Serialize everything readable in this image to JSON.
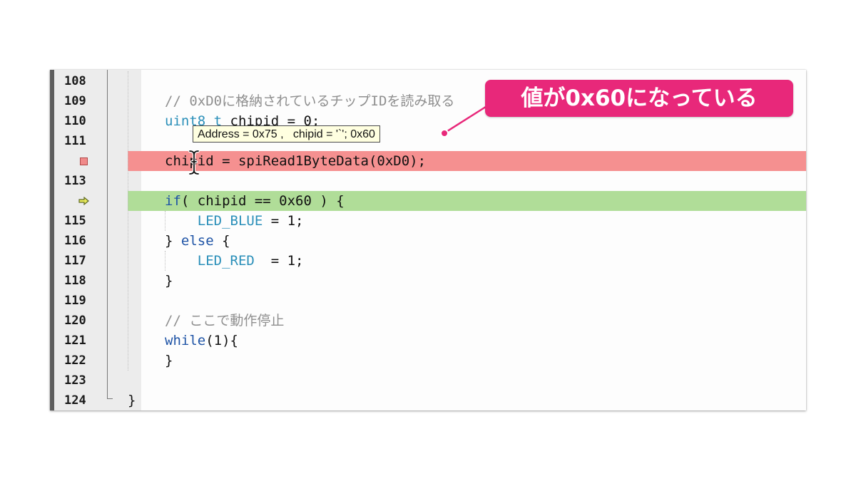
{
  "editor": {
    "lines": [
      {
        "num": "108",
        "marker": "",
        "highlight": "",
        "tokens": []
      },
      {
        "num": "109",
        "marker": "",
        "highlight": "",
        "tokens": [
          {
            "cls": "cm",
            "text": "// 0xD0に格納されているチップIDを読み取る"
          }
        ]
      },
      {
        "num": "110",
        "marker": "",
        "highlight": "",
        "tokens": [
          {
            "cls": "id",
            "text": "uint8_t"
          },
          {
            "cls": "",
            "text": " chipid = 0;"
          }
        ]
      },
      {
        "num": "111",
        "marker": "",
        "highlight": "",
        "tokens": []
      },
      {
        "num": "",
        "marker": "breakpoint",
        "highlight": "red",
        "tokens": [
          {
            "cls": "",
            "text": "chipid = spiRead1ByteData(0xD0);"
          }
        ]
      },
      {
        "num": "113",
        "marker": "",
        "highlight": "",
        "tokens": []
      },
      {
        "num": "",
        "marker": "current",
        "highlight": "green",
        "tokens": [
          {
            "cls": "kw",
            "text": "if"
          },
          {
            "cls": "",
            "text": "( chipid == 0x60 ) {"
          }
        ]
      },
      {
        "num": "115",
        "marker": "",
        "highlight": "",
        "tokens": [
          {
            "cls": "",
            "text": "    "
          },
          {
            "cls": "id",
            "text": "LED_BLUE"
          },
          {
            "cls": "",
            "text": " = 1;"
          }
        ]
      },
      {
        "num": "116",
        "marker": "",
        "highlight": "",
        "tokens": [
          {
            "cls": "",
            "text": "} "
          },
          {
            "cls": "kw",
            "text": "else"
          },
          {
            "cls": "",
            "text": " {"
          }
        ]
      },
      {
        "num": "117",
        "marker": "",
        "highlight": "",
        "tokens": [
          {
            "cls": "",
            "text": "    "
          },
          {
            "cls": "id",
            "text": "LED_RED"
          },
          {
            "cls": "",
            "text": "  = 1;"
          }
        ]
      },
      {
        "num": "118",
        "marker": "",
        "highlight": "",
        "tokens": [
          {
            "cls": "",
            "text": "}"
          }
        ]
      },
      {
        "num": "119",
        "marker": "",
        "highlight": "",
        "tokens": []
      },
      {
        "num": "120",
        "marker": "",
        "highlight": "",
        "tokens": [
          {
            "cls": "cm",
            "text": "// ここで動作停止"
          }
        ]
      },
      {
        "num": "121",
        "marker": "",
        "highlight": "",
        "tokens": [
          {
            "cls": "kw",
            "text": "while"
          },
          {
            "cls": "",
            "text": "(1){"
          }
        ]
      },
      {
        "num": "122",
        "marker": "",
        "highlight": "",
        "tokens": [
          {
            "cls": "",
            "text": "}"
          }
        ]
      },
      {
        "num": "123",
        "marker": "",
        "highlight": "",
        "tokens": []
      },
      {
        "num": "124",
        "marker": "",
        "highlight": "",
        "tokens": [
          {
            "cls": "",
            "text": "}",
            "outdent": true
          }
        ]
      }
    ]
  },
  "tooltip": {
    "text": "Address = 0x75 ,   chipid = '`'; 0x60"
  },
  "callout": {
    "text": "値が0x60になっている"
  },
  "colors": {
    "breakpoint_line": "#f59090",
    "current_line": "#b0dd98",
    "callout": "#e8287a",
    "keyword": "#1f54a6",
    "identifier": "#2a8fb9",
    "comment": "#8f8f8f"
  }
}
